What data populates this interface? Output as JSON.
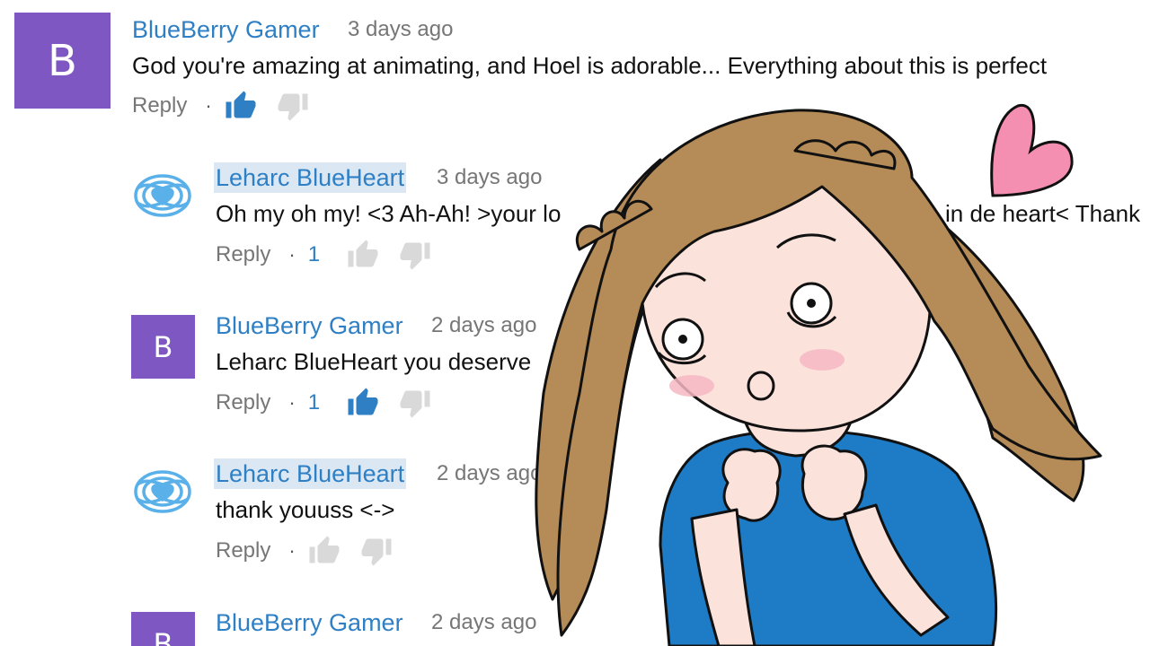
{
  "comments": [
    {
      "author": "BlueBerry Gamer",
      "time": "3 days ago",
      "text": "God you're amazing at animating, and Hoel is adorable... Everything about this is perfect",
      "avatar_letter": "B",
      "reply_label": "Reply",
      "likes": "",
      "liked": true
    },
    {
      "author": "Leharc BlueHeart",
      "time": "3 days ago",
      "text_left": "Oh my oh my! <3 Ah-Ah! >your lo",
      "text_right": "in de heart< Thank",
      "reply_label": "Reply",
      "likes": "1",
      "liked": false
    },
    {
      "author": "BlueBerry Gamer",
      "time": "2 days ago",
      "text": "Leharc BlueHeart you deserve",
      "avatar_letter": "B",
      "reply_label": "Reply",
      "likes": "1",
      "liked": true
    },
    {
      "author": "Leharc BlueHeart",
      "time": "2 days ago",
      "text": "thank youuss <->",
      "reply_label": "Reply",
      "likes": "",
      "liked": false
    },
    {
      "author": "BlueBerry Gamer",
      "time": "2 days ago",
      "avatar_letter": "B"
    }
  ],
  "colors": {
    "author": "#2f7fc4",
    "avatar": "#7e57c2",
    "liked_thumb": "#2f7fc4",
    "thumb": "#d9d9d9",
    "hair": "#b58b57",
    "dress": "#1e7bc6",
    "heart": "#f48fb1"
  },
  "icons": [
    "thumb-up-icon",
    "thumb-down-icon",
    "flower-avatar-icon",
    "heart-icon"
  ]
}
